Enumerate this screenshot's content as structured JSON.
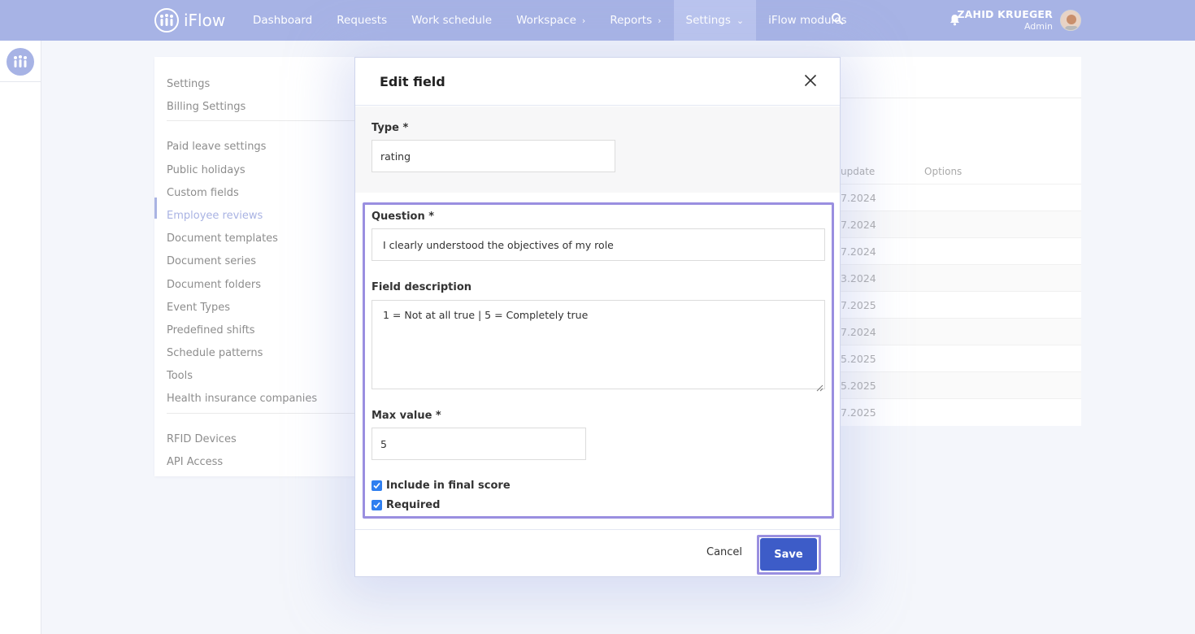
{
  "app": {
    "name": "iFlow"
  },
  "nav": {
    "items": [
      {
        "label": "Dashboard",
        "has_chevron": false,
        "active": false
      },
      {
        "label": "Requests",
        "has_chevron": false,
        "active": false
      },
      {
        "label": "Work schedule",
        "has_chevron": false,
        "active": false
      },
      {
        "label": "Workspace",
        "has_chevron": true,
        "chevron": "›",
        "active": false
      },
      {
        "label": "Reports",
        "has_chevron": true,
        "chevron": "›",
        "active": false
      },
      {
        "label": "Settings",
        "has_chevron": true,
        "chevron": "⌄",
        "active": true
      },
      {
        "label": "iFlow modules",
        "has_chevron": false,
        "active": false
      }
    ],
    "search_icon": "search-icon",
    "bell_icon": "bell-icon"
  },
  "user": {
    "name": "ZAHID KRUEGER",
    "role": "Admin"
  },
  "settings_menu": {
    "groups": [
      [
        "Settings",
        "Billing Settings"
      ],
      [
        "Paid leave settings",
        "Public holidays",
        "Custom fields",
        "Employee reviews",
        "Document templates",
        "Document series",
        "Document folders",
        "Event Types",
        "Predefined shifts",
        "Schedule patterns",
        "Tools",
        "Health insurance companies"
      ],
      [
        "RFID Devices",
        "API Access"
      ]
    ],
    "active_item": "Employee reviews"
  },
  "background_table": {
    "headers": [
      "update",
      "Options"
    ],
    "rows": [
      "7.2024",
      "7.2024",
      "7.2024",
      "3.2024",
      "7.2025",
      "7.2024",
      "5.2025",
      "5.2025",
      "7.2025"
    ]
  },
  "modal": {
    "title": "Edit field",
    "type_label": "Type *",
    "type_value": "rating",
    "question_label": "Question *",
    "question_value": "I clearly understood the objectives of my role",
    "description_label": "Field description",
    "description_value": "1 = Not at all true | 5 = Completely true",
    "max_label": "Max value *",
    "max_value": "5",
    "checkboxes": [
      {
        "label": "Include in final score",
        "checked": true
      },
      {
        "label": "Required",
        "checked": true
      }
    ],
    "cancel_label": "Cancel",
    "save_label": "Save"
  },
  "colors": {
    "topbar": "#a7b3e5",
    "accent": "#a9b3e3",
    "highlight": "#9a8fe0",
    "primary_button": "#3d5cc8",
    "checkbox": "#2f7ff0"
  }
}
